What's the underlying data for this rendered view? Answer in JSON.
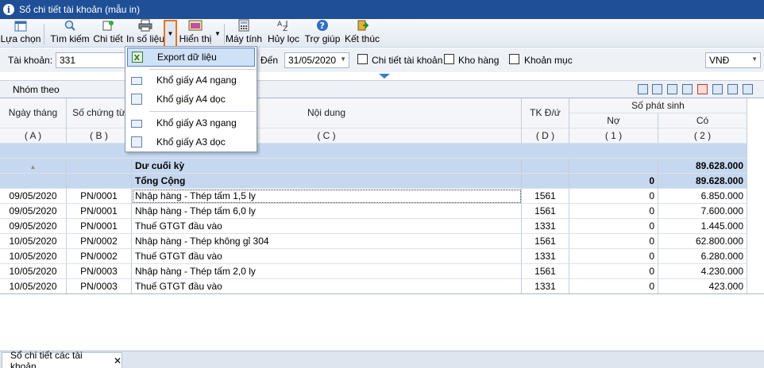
{
  "window": {
    "title": "Sổ chi tiết tài khoản (mẫu in)"
  },
  "toolbar": {
    "select": "Lựa chọn",
    "search": "Tìm kiếm",
    "detail": "Chi tiết",
    "print": "In số liệu",
    "display": "Hiển thị",
    "calculator": "Máy tính",
    "cancel_filter": "Hủy lọc",
    "help": "Trợ giúp",
    "finish": "Kết thúc"
  },
  "filter": {
    "account_label": "Tài khoản:",
    "account_value": "331",
    "to_label": "Đến",
    "to_value": "31/05/2020",
    "detail_account": "Chi tiết tài khoản",
    "warehouse": "Kho hàng",
    "item": "Khoản mục",
    "currency": "VNĐ"
  },
  "group": {
    "label": "Nhóm theo"
  },
  "table": {
    "headers": {
      "date": "Ngày tháng",
      "voucher": "Số chứng từ",
      "content": "Nội dung",
      "account": "TK Đ/ứ",
      "amount_group": "Số phát sinh",
      "debit": "Nợ",
      "credit": "Có"
    },
    "codes": {
      "a": "( A )",
      "b": "( B )",
      "c": "( C )",
      "d": "( D )",
      "one": "( 1 )",
      "two": "( 2 )"
    },
    "summary": [
      {
        "label": "Dư cuối kỳ",
        "debit": "",
        "credit": "89.628.000"
      },
      {
        "label": "Tổng Cộng",
        "debit": "0",
        "credit": "89.628.000"
      }
    ],
    "rows": [
      {
        "date": "09/05/2020",
        "voucher": "PN/0001",
        "content": "Nhập hàng - Thép tấm 1,5 ly",
        "account": "1561",
        "debit": "0",
        "credit": "6.850.000"
      },
      {
        "date": "09/05/2020",
        "voucher": "PN/0001",
        "content": "Nhập hàng - Thép tấm 6,0 ly",
        "account": "1561",
        "debit": "0",
        "credit": "7.600.000"
      },
      {
        "date": "09/05/2020",
        "voucher": "PN/0001",
        "content": "Thuế GTGT đầu vào",
        "account": "1331",
        "debit": "0",
        "credit": "1.445.000"
      },
      {
        "date": "10/05/2020",
        "voucher": "PN/0002",
        "content": "Nhập hàng - Thép không gỉ 304",
        "account": "1561",
        "debit": "0",
        "credit": "62.800.000"
      },
      {
        "date": "10/05/2020",
        "voucher": "PN/0002",
        "content": "Thuế GTGT đầu vào",
        "account": "1331",
        "debit": "0",
        "credit": "6.280.000"
      },
      {
        "date": "10/05/2020",
        "voucher": "PN/0003",
        "content": "Nhập hàng - Thép tấm 2,0 ly",
        "account": "1561",
        "debit": "0",
        "credit": "4.230.000"
      },
      {
        "date": "10/05/2020",
        "voucher": "PN/0003",
        "content": "Thuế GTGT đầu vào",
        "account": "1331",
        "debit": "0",
        "credit": "423.000"
      }
    ]
  },
  "menu": {
    "export": "Export dữ liệu",
    "a4_landscape": "Khổ giấy A4 ngang",
    "a4_portrait": "Khổ giấy A4 dọc",
    "a3_landscape": "Khổ giấy A3 ngang",
    "a3_portrait": "Khổ giấy A3 dọc"
  },
  "tabs": [
    {
      "label": "Sổ chi tiết các tài khoản"
    }
  ],
  "icons": [
    "info-icon",
    "select-icon",
    "search-icon",
    "detail-icon",
    "printer-icon",
    "display-icon",
    "calculator-icon",
    "filter-icon",
    "help-icon",
    "exit-icon",
    "close-icon"
  ],
  "colors": {
    "titlebar": "#1f4f96",
    "highlight": "#e8731c",
    "summary_row": "#c6d8f0"
  }
}
